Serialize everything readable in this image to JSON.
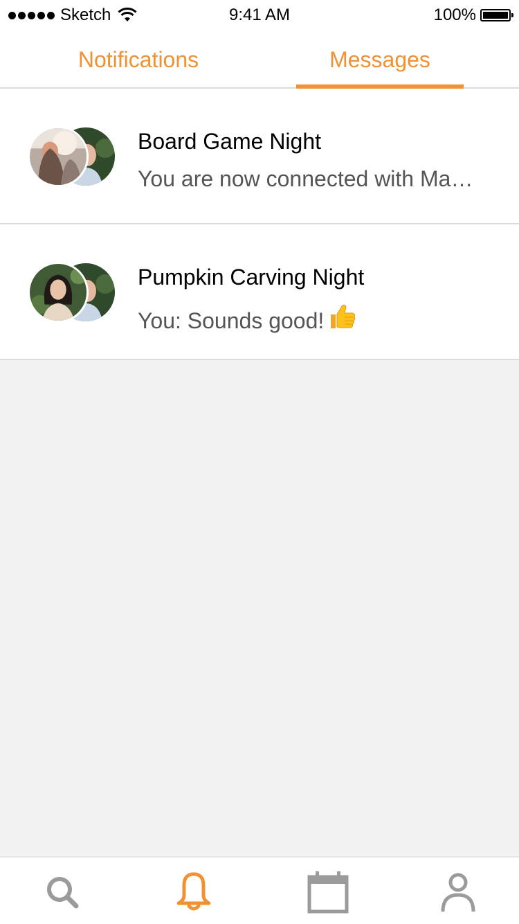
{
  "status_bar": {
    "carrier": "Sketch",
    "time": "9:41 AM",
    "battery": "100%"
  },
  "tabs": [
    {
      "label": "Notifications",
      "active": false
    },
    {
      "label": "Messages",
      "active": true
    }
  ],
  "conversations": [
    {
      "title": "Board Game Night",
      "preview": "You are now connected with Ma…",
      "avatars": [
        "group-photo-woman",
        "group-photo-man"
      ]
    },
    {
      "title": "Pumpkin Carving Night",
      "preview": "You: Sounds good!",
      "preview_emoji": "thumbs-up",
      "avatars": [
        "group-photo-woman",
        "group-photo-man"
      ]
    }
  ],
  "tab_bar": {
    "items": [
      {
        "icon": "search-icon",
        "active": false
      },
      {
        "icon": "bell-icon",
        "active": true
      },
      {
        "icon": "calendar-icon",
        "active": false
      },
      {
        "icon": "profile-icon",
        "active": false
      }
    ]
  },
  "colors": {
    "accent": "#f29132",
    "inactive_icon": "#9b9b9b",
    "background": "#f2f2f2",
    "divider": "#dcdcdc"
  }
}
